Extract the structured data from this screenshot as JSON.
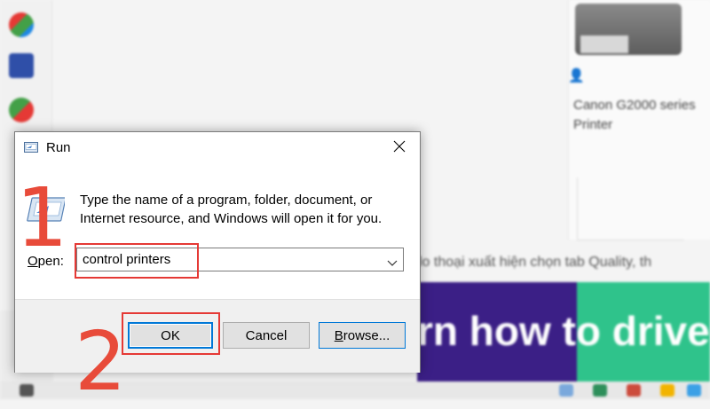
{
  "dialog": {
    "title": "Run",
    "description": "Type the name of a program, folder, document, or Internet resource, and Windows will open it for you.",
    "open_label_underlined": "O",
    "open_label_rest": "pen:",
    "input_value": "control printers",
    "buttons": {
      "ok": "OK",
      "cancel": "Cancel",
      "browse_underlined": "B",
      "browse_rest": "rowse..."
    }
  },
  "annotations": {
    "step1": "1",
    "step2": "2",
    "highlight_color": "#e53935"
  },
  "background": {
    "printer_label": "Canon G2000 series Printer",
    "partial_text": "lo thoại xuất hiện chọn tab Quality, th",
    "banner_text": "rn how to drive m"
  },
  "colors": {
    "accent": "#0078d7",
    "annotation_red": "#e84b3a"
  },
  "icons": {
    "title": "run-icon",
    "close": "close-icon",
    "dropdown": "chevron-down-icon"
  }
}
